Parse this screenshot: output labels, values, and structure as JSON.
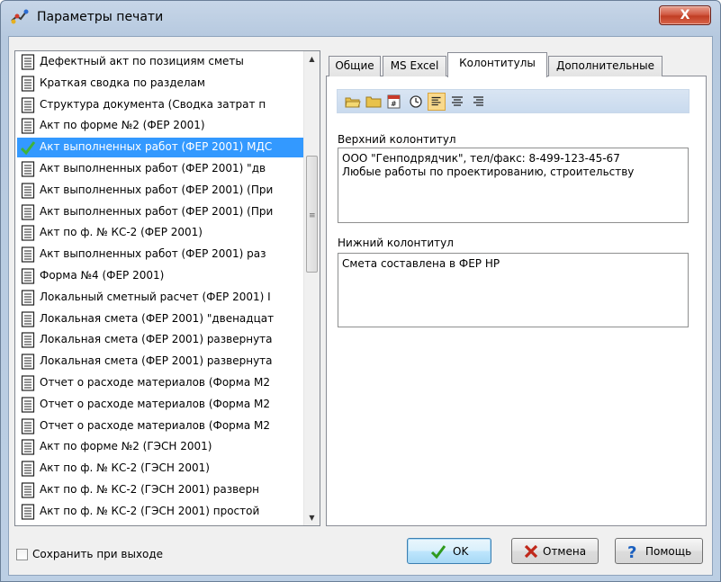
{
  "window": {
    "title": "Параметры печати",
    "close_label": "X"
  },
  "reports": {
    "items": [
      {
        "label": "Дефектный акт по позициям сметы",
        "selected": false
      },
      {
        "label": "Краткая сводка по разделам",
        "selected": false
      },
      {
        "label": "Структура документа (Сводка затрат п",
        "selected": false
      },
      {
        "label": "Акт по форме №2 (ФЕР 2001)",
        "selected": false
      },
      {
        "label": "Акт выполненных работ (ФЕР 2001) МДС",
        "selected": true
      },
      {
        "label": "Акт выполненных работ (ФЕР 2001) \"дв",
        "selected": false
      },
      {
        "label": "Акт выполненных работ (ФЕР 2001) (При",
        "selected": false
      },
      {
        "label": "Акт выполненных работ (ФЕР 2001) (При",
        "selected": false
      },
      {
        "label": "Акт по ф. № КС-2 (ФЕР 2001)",
        "selected": false
      },
      {
        "label": "Акт выполненных работ (ФЕР 2001) раз",
        "selected": false
      },
      {
        "label": "Форма №4 (ФЕР 2001)",
        "selected": false
      },
      {
        "label": "Локальный сметный расчет (ФЕР 2001) I",
        "selected": false
      },
      {
        "label": "Локальная смета (ФЕР 2001) \"двенадцат",
        "selected": false
      },
      {
        "label": "Локальная смета (ФЕР 2001) развернута",
        "selected": false
      },
      {
        "label": "Локальная смета (ФЕР 2001) развернута",
        "selected": false
      },
      {
        "label": "Отчет о расходе материалов (Форма М2",
        "selected": false
      },
      {
        "label": "Отчет о расходе материалов (Форма М2",
        "selected": false
      },
      {
        "label": "Отчет о расходе материалов (Форма М2",
        "selected": false
      },
      {
        "label": "Акт по форме №2 (ГЭСН 2001)",
        "selected": false
      },
      {
        "label": "Акт по ф. № КС-2 (ГЭСН 2001)",
        "selected": false
      },
      {
        "label": "Акт по ф. № КС-2 (ГЭСН 2001) разверн",
        "selected": false
      },
      {
        "label": "Акт по ф. № КС-2 (ГЭСН 2001) простой",
        "selected": false
      }
    ]
  },
  "tabs": [
    {
      "label": "Общие",
      "active": false
    },
    {
      "label": "MS Excel",
      "active": false
    },
    {
      "label": "Колонтитулы",
      "active": true
    },
    {
      "label": "Дополнительные",
      "active": false
    }
  ],
  "header_footer": {
    "header_label": "Верхний колонтитул",
    "header_value": "ООО \"Генподрядчик\", тел/факс: 8-499-123-45-67\nЛюбые работы по проектированию, строительству",
    "footer_label": "Нижний колонтитул",
    "footer_value": "Смета составлена в ФЕР НР"
  },
  "bottom": {
    "save_on_exit_label": "Сохранить при выходе",
    "save_on_exit_checked": false,
    "ok_label": "OK",
    "cancel_label": "Отмена",
    "help_label": "Помощь"
  },
  "colors": {
    "selection": "#3399ff",
    "toolbar_bg": "#c9daee",
    "ok_check": "#2e9a1e",
    "cancel_x": "#c0281a",
    "help_q": "#1a5fbf"
  }
}
